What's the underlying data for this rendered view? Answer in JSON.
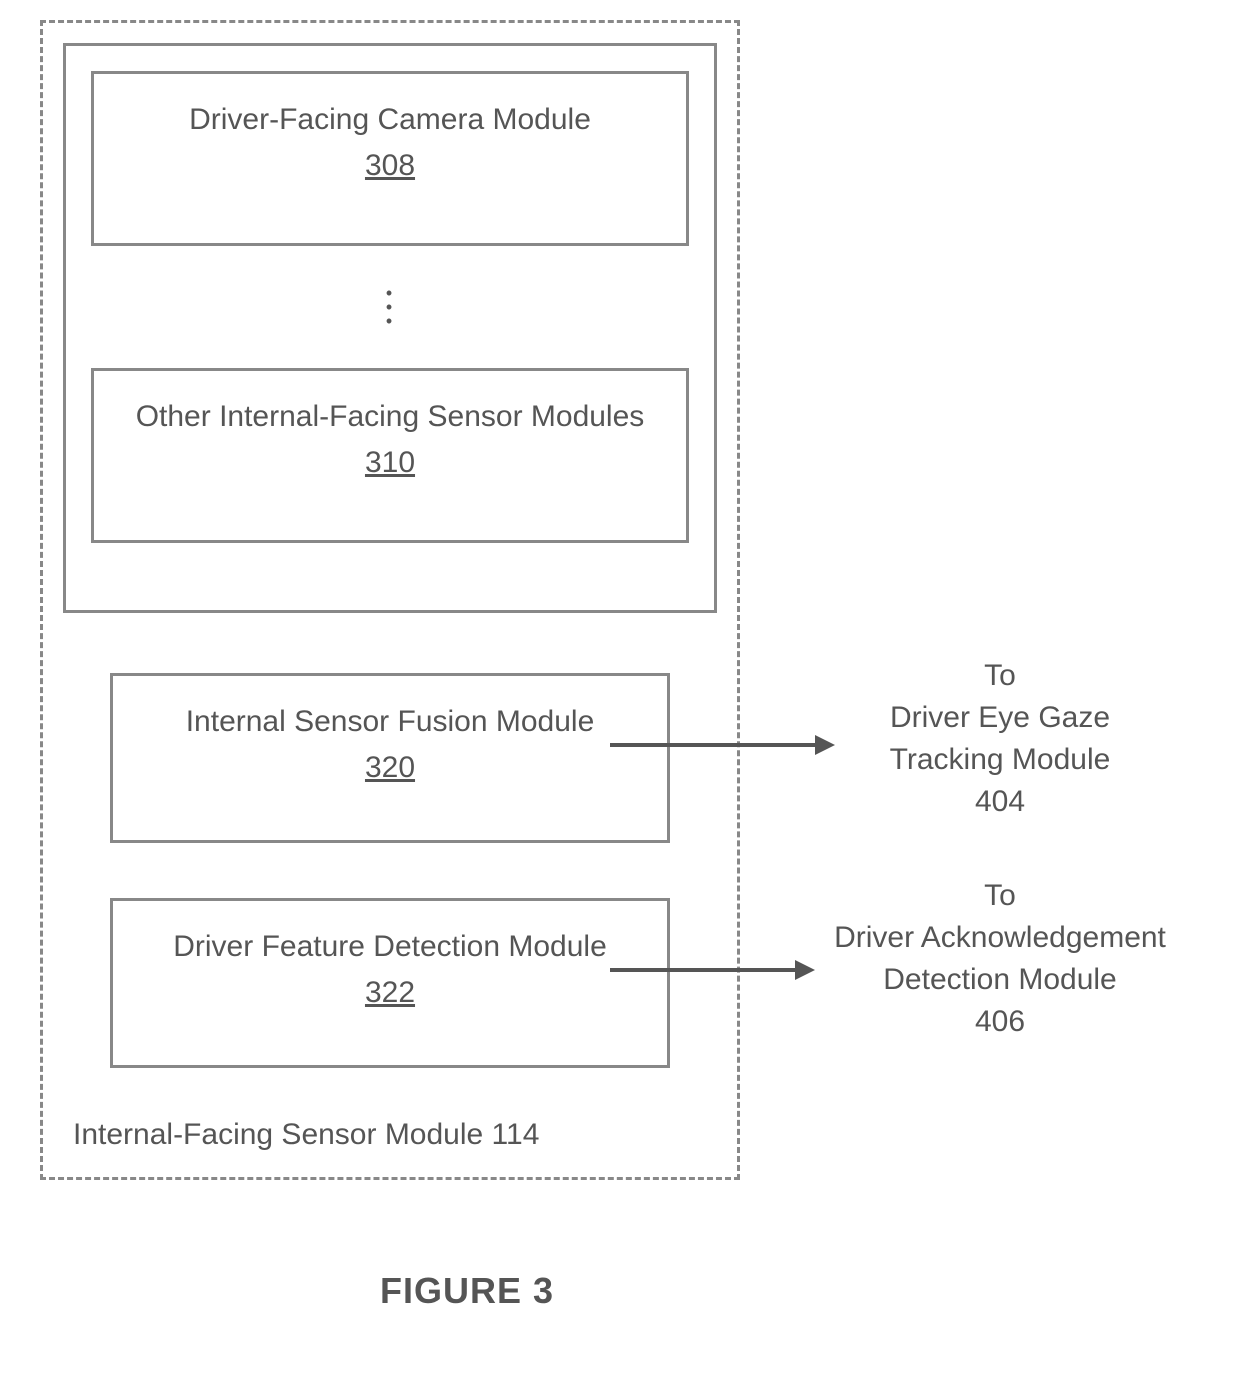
{
  "modules": {
    "camera": {
      "label": "Driver-Facing Camera Module",
      "ref": "308"
    },
    "other_sensors": {
      "label": "Other Internal-Facing Sensor Modules",
      "ref": "310"
    },
    "fusion": {
      "label": "Internal Sensor Fusion Module",
      "ref": "320"
    },
    "feature_detection": {
      "label": "Driver Feature Detection Module",
      "ref": "322"
    }
  },
  "container": {
    "label": "Internal-Facing Sensor Module 114"
  },
  "outputs": {
    "gaze": {
      "prefix": "To",
      "label": "Driver Eye Gaze Tracking Module",
      "ref": "404"
    },
    "ack": {
      "prefix": "To",
      "label": "Driver Acknowledgement Detection Module",
      "ref": "406"
    }
  },
  "figure": {
    "title": "FIGURE 3"
  },
  "dots": "•\n•\n•"
}
